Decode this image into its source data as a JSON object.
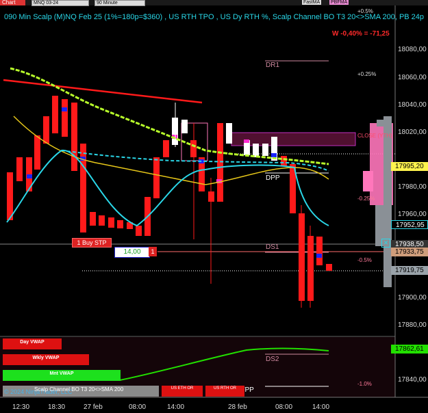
{
  "topbar": {
    "chart_label": "Chart",
    "instrument": "MNQ 03-24",
    "interval": "90 Minute",
    "btn_fastma": "FastMA",
    "btn_pbfma": "PBFMA"
  },
  "chart_title": "090 Min Scalp (M)NQ Feb 25 (1%=180p=$360) , US RTH TPO , US Dy RTH %, Scalp Channel BO T3 20<>SMA 200, PB 24p",
  "w_label": "W -0,40% = -71,25",
  "pct_labels": {
    "top": "+0.5%",
    "p025": "+0.25%",
    "close": "CLOSE (YTH)",
    "m025": "-0.25%",
    "m05": "-0.5%",
    "m10": "-1.0%"
  },
  "levels": {
    "dr1": "DR1",
    "dpp": "DPP",
    "ds1": "DS1",
    "ds2": "DS2",
    "wpp": "WPP"
  },
  "price_axis": [
    "18080,00",
    "18060,00",
    "18040,00",
    "18020,00",
    "17980,00",
    "17960,00",
    "17900,00",
    "17880,00",
    "17840,00"
  ],
  "price_tags": {
    "t1": "17995,20",
    "t2": "17952,95",
    "t3": "17938,50",
    "t4": "17933,75",
    "t5": "17919,75",
    "t6": "17862,61"
  },
  "order": {
    "buy_stp": "1 Buy STP",
    "qty": "14,00",
    "qty_count": "1",
    "close_x": "✕"
  },
  "vwap": {
    "day": "Day VWAP",
    "wkly": "Wkly VWAP",
    "mnt": "Mnt VWAP"
  },
  "bottom": {
    "scalp": "Scalp Channel BO T3 20<>SMA 200",
    "copyright": "© 2024 NinjaTrader, LLC",
    "or1": "US ETH OR",
    "or2": "US RTH OR"
  },
  "x_axis": [
    "12:30",
    "18:30",
    "27 feb",
    "08:00",
    "14:00",
    "28 feb",
    "08:00",
    "14:00"
  ],
  "colors": {
    "cyan": "#2ad7e8",
    "red": "#ff1a1a",
    "green_ma": "#b9ff2b",
    "yellow_ma": "#e7c719",
    "pink": "#ff77bb"
  }
}
